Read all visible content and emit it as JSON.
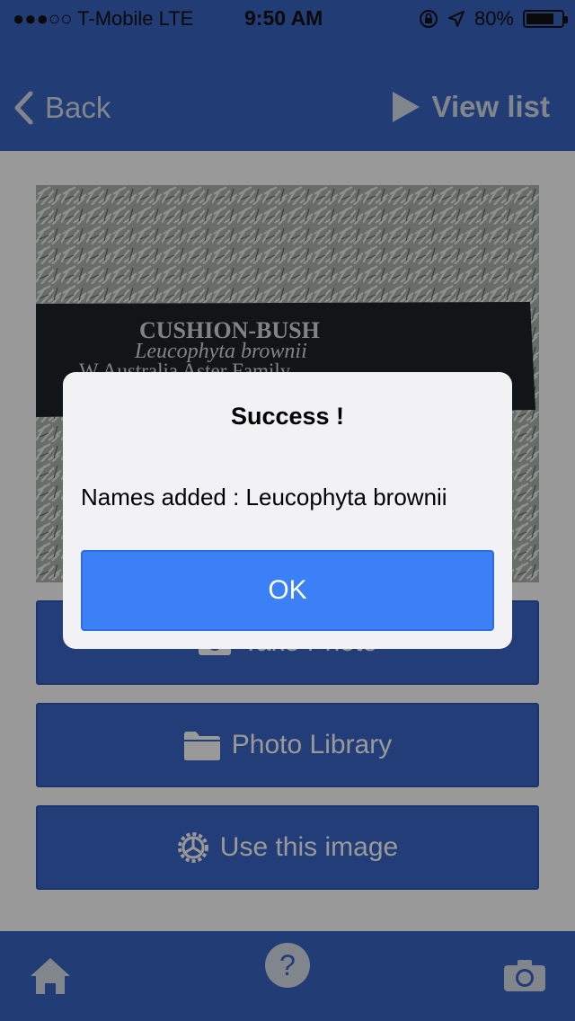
{
  "status_bar": {
    "carrier": "●●●○○ T-Mobile  LTE",
    "time": "9:50 AM",
    "battery": "80%",
    "battery_level": 0.8
  },
  "nav": {
    "back_label": "Back",
    "view_list_label": "View list"
  },
  "photo": {
    "sign_title": "CUSHION-BUSH",
    "sign_species": "Leucophyta brownii",
    "sign_origin": "W Australia    Aster Family"
  },
  "actions": {
    "take_photo": "Take Photo",
    "photo_library": "Photo Library",
    "use_image": "Use this image"
  },
  "alert": {
    "title": "Success !",
    "message": "Names added : Leucophyta brownii",
    "ok_label": "OK"
  },
  "colors": {
    "brand_blue": "#3a64c4",
    "ok_blue": "#3b80f5"
  }
}
